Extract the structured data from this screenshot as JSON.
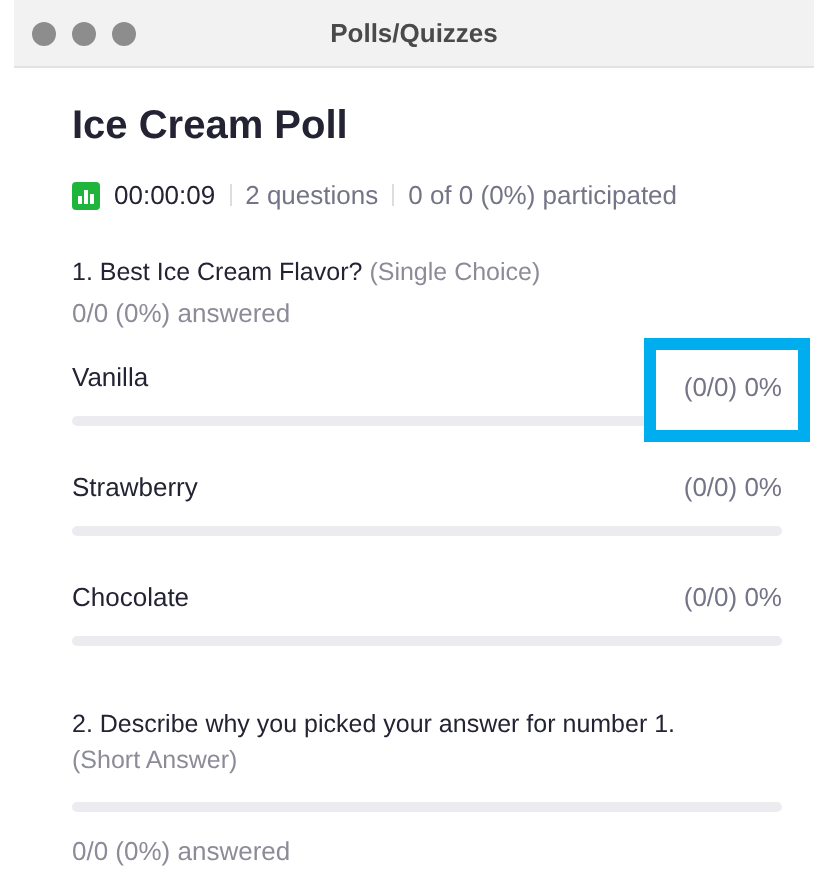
{
  "window": {
    "title": "Polls/Quizzes"
  },
  "poll": {
    "title": "Ice Cream Poll",
    "timer": "00:00:09",
    "questions_count": "2 questions",
    "participation": "0 of 0 (0%) participated"
  },
  "questions": [
    {
      "kind": "single_choice",
      "text": "1. Best Ice Cream Flavor?",
      "type": "(Single Choice)",
      "answered": "0/0 (0%) answered",
      "options": [
        {
          "label": "Vanilla",
          "reading": "(0/0) 0%",
          "level": 0,
          "highlighted": true
        },
        {
          "label": "Strawberry",
          "reading": "(0/0) 0%",
          "level": 0,
          "highlighted": false
        },
        {
          "label": "Chocolate",
          "reading": "(0/0) 0%",
          "level": 0,
          "highlighted": false
        }
      ]
    },
    {
      "kind": "short_answer",
      "text": "2. Describe why you picked your answer for number 1.",
      "type": "(Short Answer)",
      "level": 0,
      "answered": "0/0 (0%) answered"
    }
  ]
}
